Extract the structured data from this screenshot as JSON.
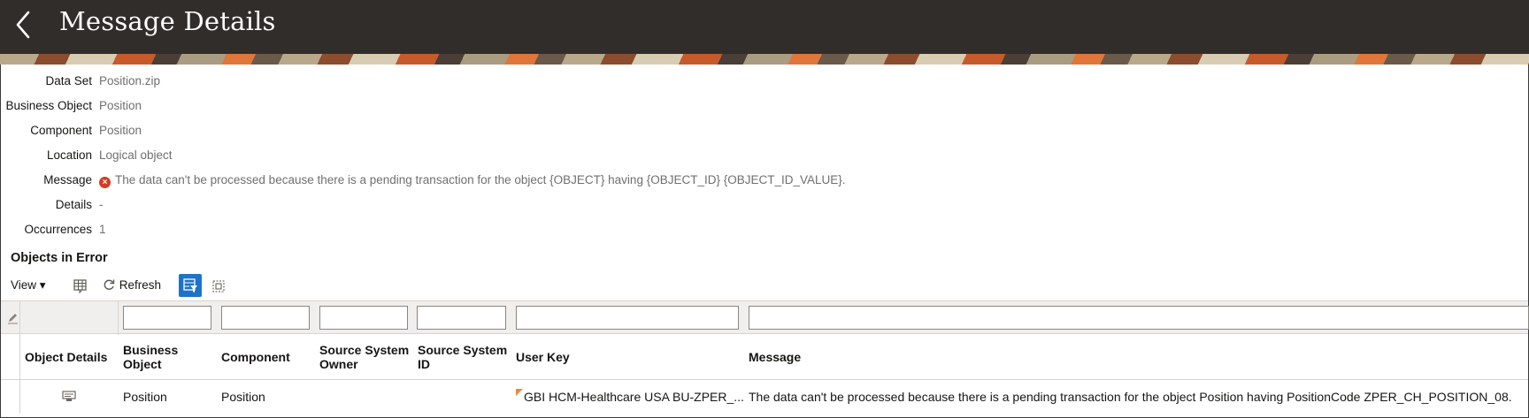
{
  "header": {
    "title": "Message Details"
  },
  "details": {
    "data_set_label": "Data Set",
    "data_set_value": "Position.zip",
    "business_object_label": "Business Object",
    "business_object_value": "Position",
    "component_label": "Component",
    "component_value": "Position",
    "location_label": "Location",
    "location_value": "Logical object",
    "message_label": "Message",
    "message_value": "The data can't be processed because there is a pending transaction for the object {OBJECT} having {OBJECT_ID} {OBJECT_ID_VALUE}.",
    "details_label": "Details",
    "details_value": "-",
    "occurrences_label": "Occurrences",
    "occurrences_value": "1"
  },
  "objects_in_error": {
    "title": "Objects in Error",
    "toolbar": {
      "view_label": "View ▾",
      "refresh_label": "Refresh"
    },
    "columns": [
      "Object Details",
      "Business Object",
      "Component",
      "Source System Owner",
      "Source System ID",
      "User Key",
      "Message"
    ],
    "rows": [
      {
        "business_object": "Position",
        "component": "Position",
        "source_system_owner": "",
        "source_system_id": "",
        "user_key": "GBI HCM-Healthcare USA BU-ZPER_...",
        "message": "The data can't be processed because there is a pending transaction for the object Position having PositionCode ZPER_CH_POSITION_08."
      }
    ]
  },
  "colors": {
    "header_bg": "#312d2a",
    "error_icon": "#d63b25",
    "qbe_active": "#1e73c8",
    "user_key_flag": "#e98a3f"
  }
}
